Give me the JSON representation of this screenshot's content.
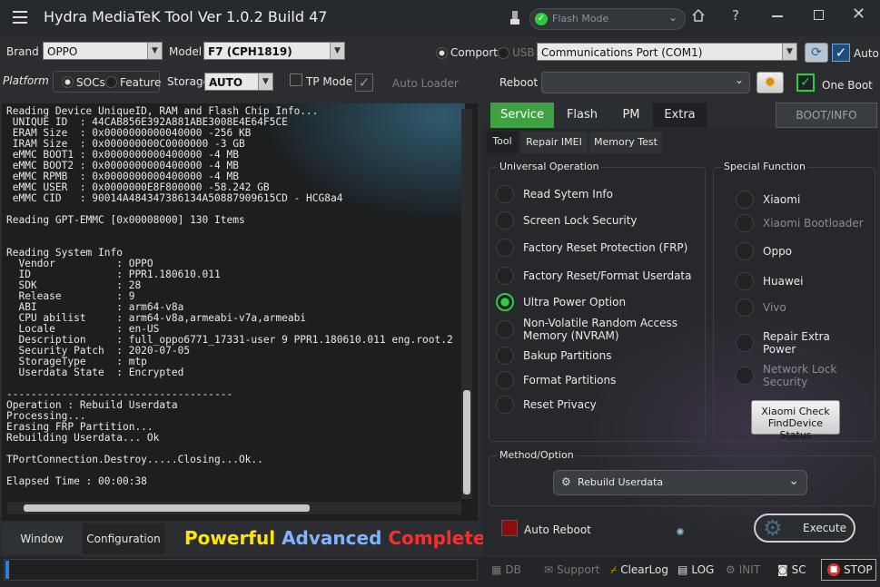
{
  "app": {
    "title": "Hydra MediaTeK Tool  Ver 1.0.2 Build 47",
    "status": "Flash Mode"
  },
  "toolbar": {
    "brand_label": "Brand",
    "brand_value": "OPPO",
    "model_label": "Model",
    "model_value": "F7 (CPH1819)",
    "comport_label": "Comport",
    "usb_label": "USB",
    "port_value": "Communications Port (COM1)",
    "auto_label": "Auto"
  },
  "platform": {
    "label": "Platform",
    "socs_label": "SOCs",
    "feature_label": "Feature",
    "storage_label": "Storage",
    "storage_value": "AUTO",
    "tp_mode_label": "TP Mode",
    "auto_loader_label": "Auto Loader",
    "reboot_label": "Reboot",
    "reboot_value": "",
    "one_boot_label": "One Boot"
  },
  "console": {
    "text": "Reading Device UniqueID, RAM and Flash Chip Info...\n UNIQUE ID  : 44CAB856E392A881ABE3008E4E64F5CE\n ERAM Size  : 0x0000000000040000 -256 KB\n IRAM Size  : 0x000000000C0000000 -3 GB\n eMMC BOOT1 : 0x0000000000400000 -4 MB\n eMMC BOOT2 : 0x0000000000400000 -4 MB\n eMMC RPMB  : 0x0000000000400000 -4 MB\n eMMC USER  : 0x0000000E8F800000 -58.242 GB\n eMMC CID   : 90014A484347386134A50887909615CD - HCG8a4\n\nReading GPT-EMMC [0x00008000] 130 Items\n\n\nReading System Info\n  Vendor          : OPPO\n  ID              : PPR1.180610.011\n  SDK             : 28\n  Release         : 9\n  ABI             : arm64-v8a\n  CPU abilist     : arm64-v8a,armeabi-v7a,armeabi\n  Locale          : en-US\n  Description     : full_oppo6771_17331-user 9 PPR1.180610.011 eng.root.2\n  Security Patch  : 2020-07-05\n  StorageType     : mtp\n  Userdata State  : Encrypted\n\n-------------------------------------\nOperation : Rebuild Userdata\nProcessing...\nErasing FRP Partition...\nRebuilding Userdata... Ok\n\nTPortConnection.Destroy.....Closing...Ok..\n\nElapsed Time : 00:00:38"
  },
  "bottom_tabs": {
    "window": "Window",
    "configuration": "Configuration"
  },
  "slogan": {
    "powerful": "Powerful",
    "advanced": "Advanced",
    "complete": "Complete"
  },
  "main_tabs": {
    "service": "Service",
    "flash": "Flash",
    "pm": "PM",
    "extra": "Extra",
    "boot_info": "BOOT/INFO"
  },
  "sub_tabs": {
    "tool": "Tool",
    "repair_imei": "Repair IMEI",
    "memory_test": "Memory Test"
  },
  "universal": {
    "title": "Universal Operation",
    "items": [
      "Read Sytem Info",
      "Screen Lock Security",
      "Factory Reset Protection (FRP)",
      "Factory Reset/Format Userdata",
      "Ultra Power Option",
      "Non-Volatile Random Access Memory (NVRAM)",
      "Bakup Partitions",
      "Format Partitions",
      "Reset Privacy"
    ]
  },
  "special": {
    "title": "Special Function",
    "items": [
      "Xiaomi",
      "Xiaomi Bootloader",
      "Oppo",
      "Huawei",
      "Vivo",
      "Repair Extra Power",
      "Network Lock Security"
    ],
    "check_button": "Xiaomi Check FindDevice Status"
  },
  "method": {
    "title": "Method/Option",
    "value": "Rebuild Userdata"
  },
  "auto_reboot_label": "Auto Reboot",
  "execute_label": "Execute",
  "statusbar": {
    "db": "DB",
    "support": "Support",
    "clearlog": "ClearLog",
    "log": "LOG",
    "init": "INIT",
    "sc": "SC",
    "stop": "STOP"
  },
  "colors": {
    "accent_green": "#2ecc40",
    "service_tab": "#3fa142",
    "slogan_yellow": "#ffe600",
    "slogan_blue": "#7fb2ff",
    "slogan_red": "#ff2a2a"
  }
}
